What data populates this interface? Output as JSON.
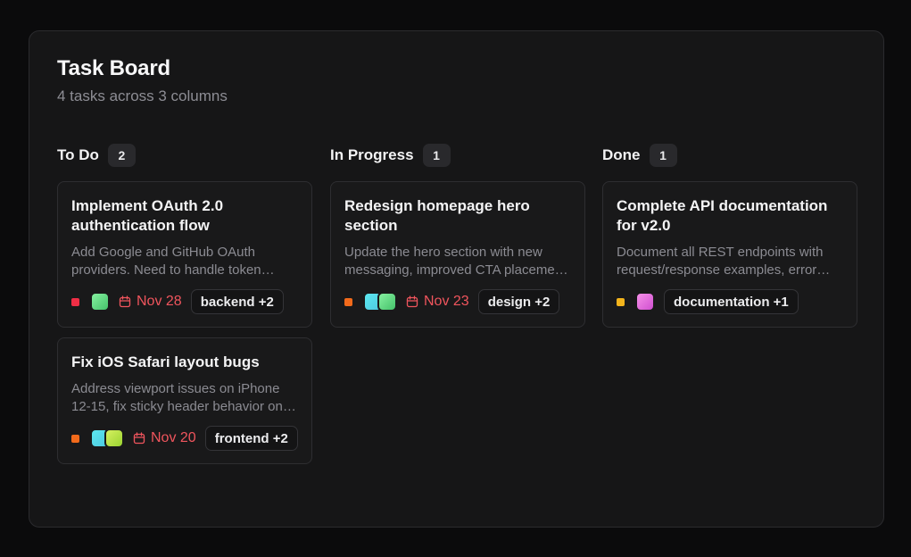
{
  "board": {
    "title": "Task Board",
    "subtitle": "4 tasks across 3 columns"
  },
  "columns": [
    {
      "title": "To Do",
      "count": "2",
      "cards": [
        {
          "title": "Implement OAuth 2.0 authentication flow",
          "description": "Add Google and GitHub OAuth providers. Need to handle token refresh and secure storage.",
          "priority_color": "#ef2e45",
          "avatars": [
            "linear-gradient(135deg,#86f0a0,#45c26a)"
          ],
          "due": "Nov 28",
          "tag": "backend +2"
        },
        {
          "title": "Fix iOS Safari layout bugs",
          "description": "Address viewport issues on iPhone 12-15, fix sticky header behavior on scroll.",
          "priority_color": "#f26a1b",
          "avatars": [
            "linear-gradient(135deg,#5de8f0,#4cc8e0)",
            "linear-gradient(135deg,#d6f060,#9ad330)"
          ],
          "due": "Nov 20",
          "tag": "frontend +2"
        }
      ]
    },
    {
      "title": "In Progress",
      "count": "1",
      "cards": [
        {
          "title": "Redesign homepage hero section",
          "description": "Update the hero section with new messaging, improved CTA placement and visuals.",
          "priority_color": "#f26a1b",
          "avatars": [
            "linear-gradient(135deg,#5de8f0,#4cc8e0)",
            "linear-gradient(135deg,#86f0a0,#45c26a)"
          ],
          "due": "Nov 23",
          "tag": "design +2"
        }
      ]
    },
    {
      "title": "Done",
      "count": "1",
      "cards": [
        {
          "title": "Complete API documentation for v2.0",
          "description": "Document all REST endpoints with request/response examples, error codes and auth.",
          "priority_color": "#f3b41c",
          "avatars": [
            "linear-gradient(135deg,#f590e8,#d04fd0)"
          ],
          "due": "",
          "tag": "documentation +1"
        }
      ]
    }
  ],
  "icons": {
    "due": "calendar-icon"
  }
}
